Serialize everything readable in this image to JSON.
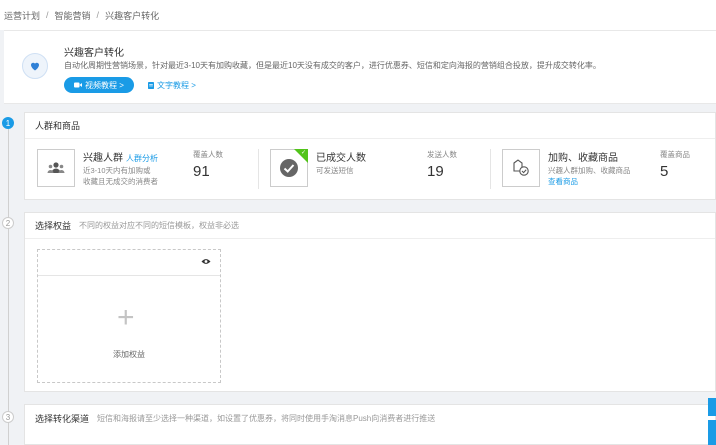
{
  "breadcrumb": {
    "items": [
      "运营计划",
      "智能营销",
      "兴趣客户转化"
    ],
    "separator": "/"
  },
  "intro": {
    "title": "兴趣客户转化",
    "description": "自动化周期性营销场景，针对最近3-10天有加购收藏，但是最近10天没有成交的客户，进行优惠券、短信和定向海报的营销组合投放，提升成交转化率。",
    "video_button": "视频教程 >",
    "text_link": "文字教程 >"
  },
  "steps": [
    {
      "number": "1",
      "title": "人群和商品",
      "subtitle": ""
    },
    {
      "number": "2",
      "title": "选择权益",
      "subtitle": "不同的权益对应不同的短信模板，权益非必选"
    },
    {
      "number": "3",
      "title": "选择转化渠道",
      "subtitle": "短信和海报请至少选择一种渠道，如设置了优惠券，将同时使用手淘消息Push向消费者进行推送"
    }
  ],
  "crowd": {
    "title": "兴趣人群",
    "analysis_link": "人群分析",
    "desc_line1": "近3-10天内有加购或",
    "desc_line2": "收藏且无成交的消费者",
    "coverage_label": "覆盖人数",
    "coverage_value": "91"
  },
  "deal": {
    "title": "已成交人数",
    "desc": "可发送短信",
    "send_label": "发送人数",
    "send_value": "19"
  },
  "goods": {
    "title": "加购、收藏商品",
    "desc": "兴趣人群加购、收藏商品",
    "view_link": "查看商品",
    "coverage_label": "覆盖商品",
    "coverage_value": "5"
  },
  "benefit": {
    "add_label": "添加权益"
  },
  "colors": {
    "accent": "#1a9be6",
    "success": "#52c41a"
  },
  "icons": {
    "intro": "heart-icon",
    "video": "video-icon",
    "doc": "document-icon",
    "crowd": "group-icon",
    "deal": "check-circle-icon",
    "goods": "goods-icon",
    "preview": "eye-icon",
    "add": "plus-icon"
  }
}
